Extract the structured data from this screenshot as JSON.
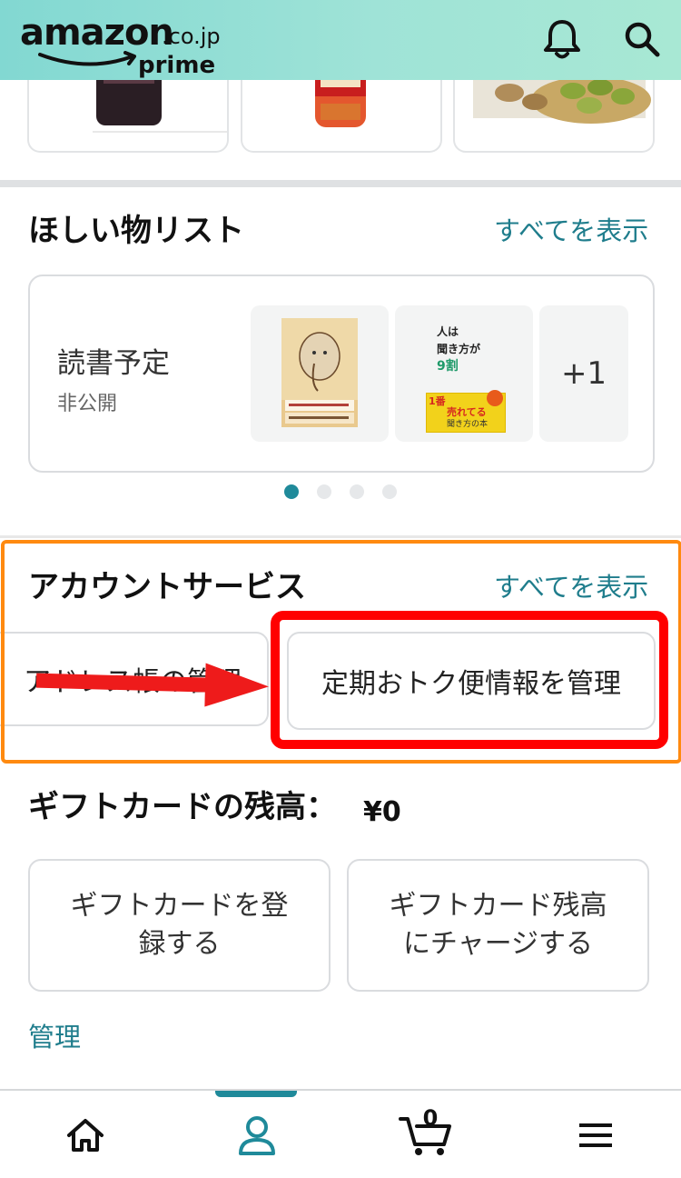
{
  "header": {
    "logo_word": "amazon",
    "logo_tld": ".co.jp",
    "logo_prime": "prime",
    "notification_icon": "bell-icon",
    "search_icon": "search-icon"
  },
  "wishlist": {
    "title": "ほしい物リスト",
    "see_all": "すべてを表示",
    "list_name": "読書予定",
    "visibility": "非公開",
    "more_count": "+1",
    "book2_lines": [
      "人は",
      "聞き方が",
      "9割"
    ],
    "book2_badge": "1番",
    "book2_badge2": "売れてる",
    "book2_badge3": "聞き方の本",
    "page_indicator": {
      "total": 4,
      "active": 1
    }
  },
  "account_services": {
    "title": "アカウントサービス",
    "see_all": "すべてを表示",
    "items": [
      "アドレス帳の管理",
      "定期おトク便情報を管理"
    ]
  },
  "gift_card": {
    "title": "ギフトカードの残高：",
    "balance": "¥0",
    "buttons": [
      "ギフトカードを登録する",
      "ギフトカード残高にチャージする"
    ],
    "manage_link": "管理"
  },
  "bottom_nav": {
    "items": [
      "home-icon",
      "account-icon",
      "cart-icon",
      "menu-icon"
    ],
    "cart_count": "0",
    "active": "account-icon"
  },
  "colors": {
    "header_gradient_start": "#82d8d2",
    "header_gradient_end": "#a8e8d4",
    "link": "#1f7d8c",
    "active_teal": "#1f8a9a",
    "annotation_orange": "#ff8a10",
    "annotation_red": "#ff0000"
  }
}
